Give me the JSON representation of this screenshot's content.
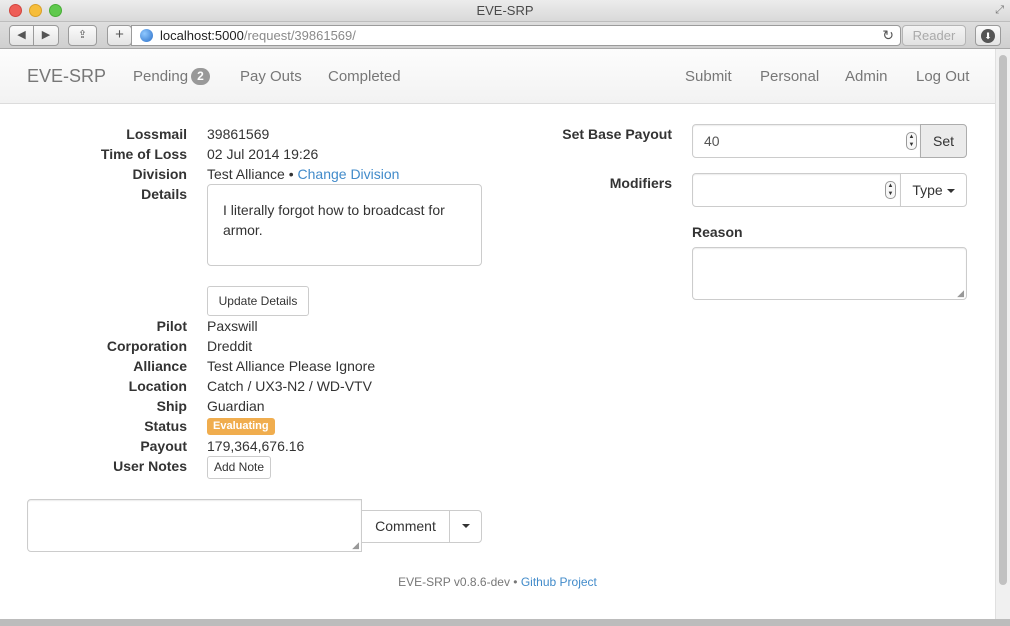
{
  "window": {
    "title": "EVE-SRP",
    "url_host": "localhost:5000",
    "url_path": "/request/39861569/",
    "reader_label": "Reader"
  },
  "nav": {
    "brand": "EVE-SRP",
    "pending_label": "Pending",
    "pending_count": "2",
    "payouts_label": "Pay Outs",
    "completed_label": "Completed",
    "submit_label": "Submit",
    "personal_label": "Personal",
    "admin_label": "Admin",
    "logout_label": "Log Out"
  },
  "request": {
    "lossmail_label": "Lossmail",
    "lossmail_value": "39861569",
    "time_label": "Time of Loss",
    "time_value": "02 Jul 2014 19:26",
    "division_label": "Division",
    "division_value": "Test Alliance",
    "division_separator": "•",
    "change_division_label": "Change Division",
    "details_label": "Details",
    "details_text": "I literally forgot how to broadcast for armor.",
    "update_details_label": "Update Details",
    "pilot_label": "Pilot",
    "pilot_value": "Paxswill",
    "corporation_label": "Corporation",
    "corporation_value": "Dreddit",
    "alliance_label": "Alliance",
    "alliance_value": "Test Alliance Please Ignore",
    "location_label": "Location",
    "location_value": "Catch / UX3-N2 / WD-VTV",
    "ship_label": "Ship",
    "ship_value": "Guardian",
    "status_label": "Status",
    "status_value": "Evaluating",
    "status_color": "#f0ad4e",
    "payout_label": "Payout",
    "payout_value": "179,364,676.16",
    "user_notes_label": "User Notes",
    "add_note_label": "Add Note"
  },
  "payout_form": {
    "base_payout_label": "Set Base Payout",
    "base_payout_value": "40",
    "set_button_label": "Set",
    "modifiers_label": "Modifiers",
    "modifiers_value": "",
    "type_button_label": "Type",
    "reason_label": "Reason",
    "reason_value": ""
  },
  "comment": {
    "comment_button_label": "Comment",
    "comment_value": ""
  },
  "footer": {
    "version_text": "EVE-SRP v0.8.6-dev",
    "separator": "•",
    "github_label": "Github Project"
  }
}
